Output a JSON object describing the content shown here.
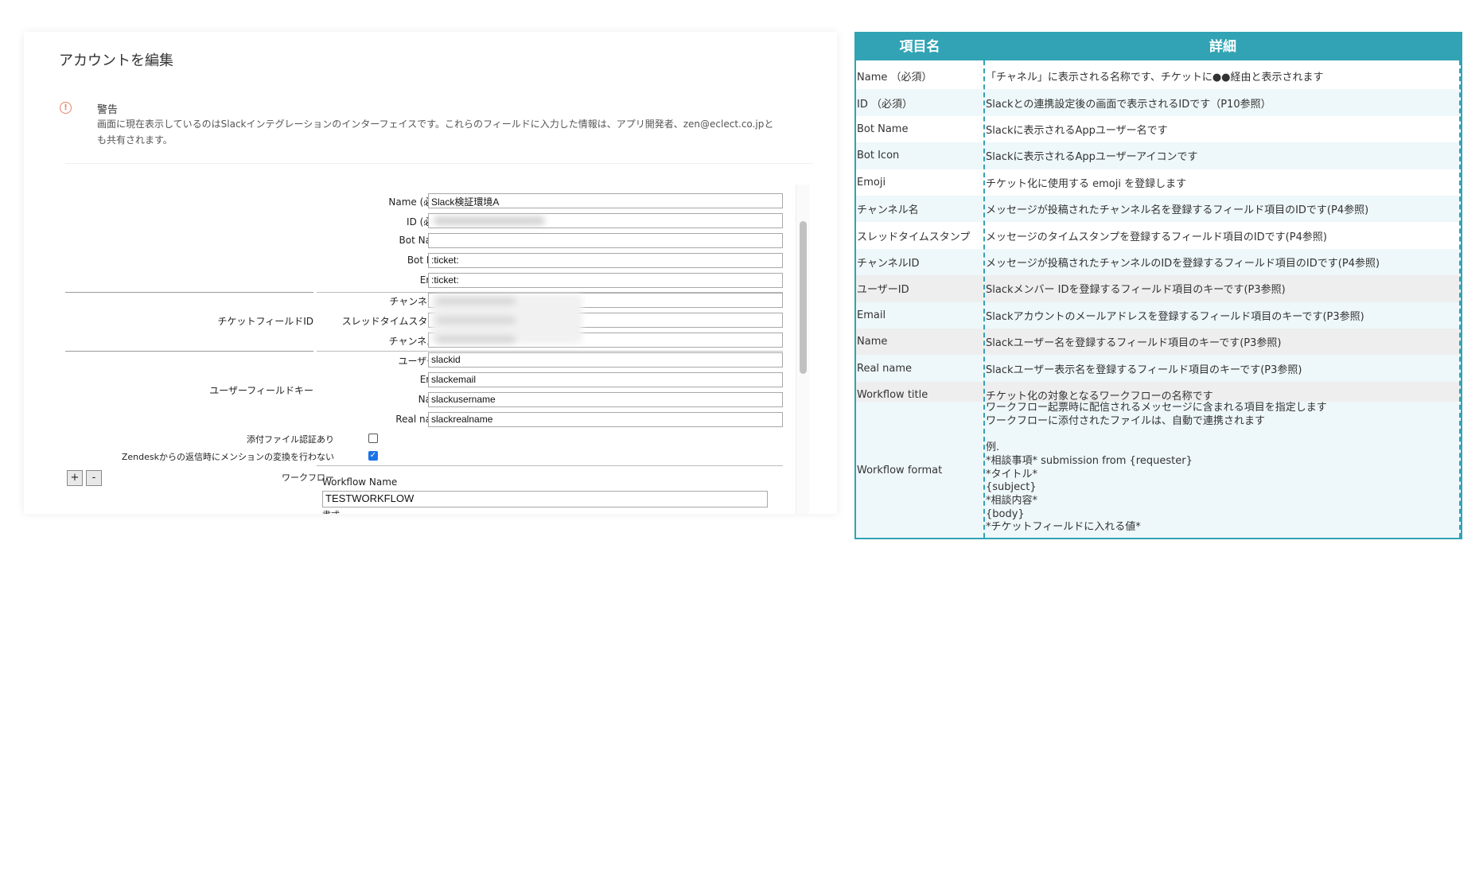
{
  "panel": {
    "title": "アカウントを編集",
    "warning_title": "警告",
    "warning_text": "画面に現在表示しているのはSlackインテグレーションのインターフェイスです。これらのフィールドに入力した情報は、アプリ開発者、zen@eclect.co.jpとも共有されます。"
  },
  "form": {
    "name_label": "Name (必須)",
    "name_value": "Slack検証環境A",
    "id_label": "ID (必須)",
    "botname_label": "Bot Name",
    "boticon_label": "Bot Icon",
    "boticon_value": ":ticket:",
    "emoji_label": "Emoji",
    "emoji_value": ":ticket:",
    "ticket_field_group": "チケットフィールドID",
    "channel_name_label": "チャンネル名",
    "thread_ts_label": "スレッドタイムスタンプ",
    "channel_id_label": "チャンネルID",
    "user_field_group": "ユーザーフィールドキー",
    "user_id_label": "ユーザーID",
    "user_id_value": "slackid",
    "email_label": "Email",
    "email_value": "slackemail",
    "uname_label": "Name",
    "uname_value": "slackusername",
    "realname_label": "Real name",
    "realname_value": "slackrealname",
    "attach_label": "添付ファイル認証あり",
    "attach_checked": false,
    "mention_label": "Zendeskからの返信時にメンションの変換を行わない",
    "mention_checked": true,
    "plus_label": "+",
    "minus_label": "-",
    "workflow_label": "ワークフロー",
    "workflow_name_label": "Workflow Name",
    "workflow_name_value": "TESTWORKFLOW",
    "format_label": "書式"
  },
  "table": {
    "header_item": "項目名",
    "header_detail": "詳細",
    "rows": [
      {
        "item": "Name （必須）",
        "detail": "「チャネル」に表示される名称です、チケットに●●経由と表示されます"
      },
      {
        "item": "ID （必須）",
        "detail": "Slackとの連携設定後の画面で表示されるIDです（P10参照）"
      },
      {
        "item": "Bot Name",
        "detail": "Slackに表示されるAppユーザー名です"
      },
      {
        "item": "Bot Icon",
        "detail": "Slackに表示されるAppユーザーアイコンです"
      },
      {
        "item": "Emoji",
        "detail": "チケット化に使用する emoji を登録します"
      },
      {
        "item": "チャンネル名",
        "detail": "メッセージが投稿されたチャンネル名を登録するフィールド項目のIDです(P4参照)"
      },
      {
        "item": "スレッドタイムスタンプ",
        "detail": "メッセージのタイムスタンプを登録するフィールド項目のIDです(P4参照)"
      },
      {
        "item": "チャンネルID",
        "detail": "メッセージが投稿されたチャンネルのIDを登録するフィールド項目のIDです(P4参照)"
      },
      {
        "item": "ユーザーID",
        "detail": "Slackメンバー IDを登録するフィールド項目のキーです(P3参照)"
      },
      {
        "item": "Email",
        "detail": "Slackアカウントのメールアドレスを登録するフィールド項目のキーです(P3参照)"
      },
      {
        "item": "Name",
        "detail": "Slackユーザー名を登録するフィールド項目のキーです(P3参照)"
      },
      {
        "item": "Real name",
        "detail": "Slackユーザー表示名を登録するフィールド項目のキーです(P3参照)"
      },
      {
        "item": "Workflow title",
        "detail": "チケット化の対象となるワークフローの名称です"
      }
    ],
    "workflow_format_item": "Workflow format",
    "workflow_format_lines": [
      "ワークフロー起票時に配信されるメッセージに含まれる項目を指定します",
      "ワークフローに添付されたファイルは、自動で連携されます",
      "",
      "例.",
      "*相談事項* submission from {requester}",
      "*タイトル*",
      "{subject}",
      "*相談内容*",
      "{body}",
      "*チケットフィールドに入れる値*"
    ],
    "colors": {
      "header": "#31a3b5",
      "row_alt": "#eef7f9",
      "row_plain": "#ffffff",
      "row_grey": "#eeeeee"
    }
  }
}
